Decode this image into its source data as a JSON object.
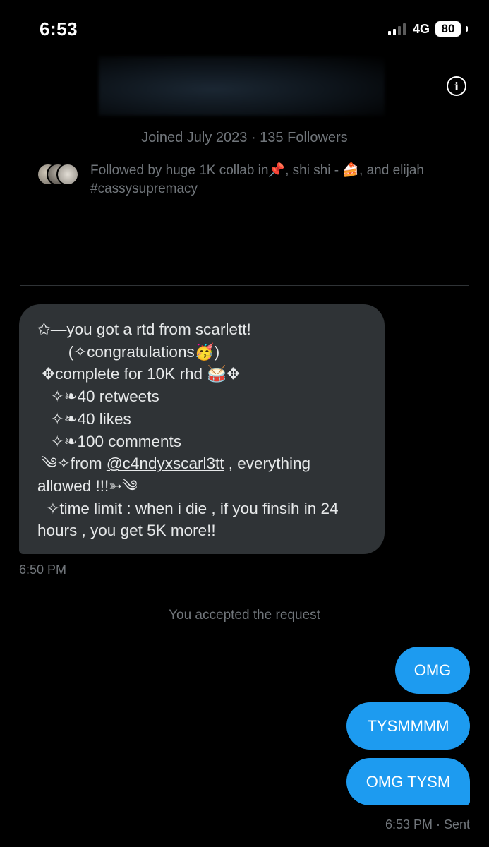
{
  "status_bar": {
    "time": "6:53",
    "network": "4G",
    "battery": "80"
  },
  "profile": {
    "info_icon": "info-icon",
    "joined": "Joined July 2023 · 135 Followers",
    "followed_line1": "Followed by huge 1K collab in📌, shi shi - 🍰, and elijah",
    "followed_line2": "#cassysupremacy"
  },
  "conversation": {
    "received_lines": [
      "✩—you got a rtd from scarlett!",
      "       (✧congratulations🥳)",
      " ✥complete for 10K rhd 🥁✥",
      "   ✧❧40 retweets",
      "   ✧❧40 likes",
      "   ✧❧100 comments",
      " ༄✧from ",
      "allowed !!!➳༄",
      "  ✧time limit : when i die , if you finsih in 24",
      "hours , you get 5K more!!"
    ],
    "mention": "@c4ndyxscarl3tt",
    "mention_suffix": " , everything",
    "received_time": "6:50 PM",
    "system_message": "You accepted the request",
    "sent": [
      "OMG",
      "TYSMMMM",
      "OMG TYSM"
    ],
    "sent_status": "6:53 PM · Sent"
  },
  "colors": {
    "background": "#000000",
    "bubble_in": "#2f3336",
    "bubble_out": "#1d9bf0",
    "muted_text": "#71767b"
  }
}
